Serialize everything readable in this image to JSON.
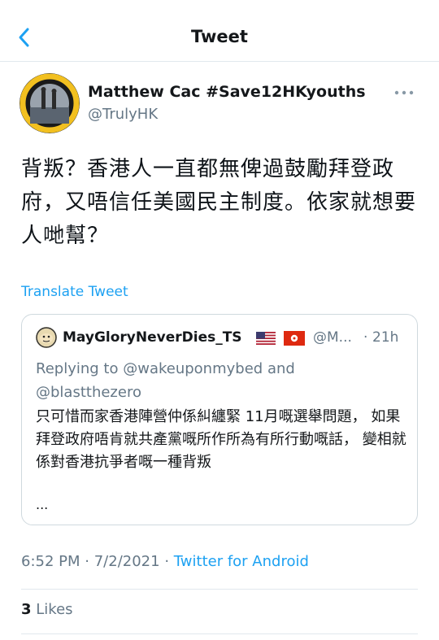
{
  "header": {
    "title": "Tweet"
  },
  "tweet": {
    "author": {
      "name": "Matthew Cac #Save12HKyouths",
      "handle": "@TrulyHK",
      "avatar_text": "LET FIGHT FOR OUR FREEDOM & FUTURE"
    },
    "text": "背叛？香港人一直都無俾過鼓勵拜登政府，又唔信任美國民主制度。依家就想要人哋幫？",
    "translate_label": "Translate Tweet",
    "time": "6:52 PM",
    "date": "7/2/2021",
    "separator": "·",
    "source": "Twitter for Android",
    "likes_count": "3",
    "likes_label": "Likes"
  },
  "quote": {
    "name": "MayGloryNeverDies_TS",
    "handle": "@M...",
    "separator": "·",
    "time": "21h",
    "replying_prefix": "Replying to",
    "reply_user1": "@wakeuponmybed",
    "reply_and": "and",
    "reply_user2": "@blastthezero",
    "text": "只可惜而家香港陣營仲係糾纏緊 11月嘅選舉問題， 如果拜登政府唔肯就共產黨嘅所作所為有所行動嘅話， 變相就係對香港抗爭者嘅一種背叛",
    "ellipsis": "..."
  },
  "colors": {
    "accent": "#1da1f2",
    "secondary_text": "#657786",
    "border": "#e1e8ed",
    "avatar_ring": "#f2c020"
  }
}
